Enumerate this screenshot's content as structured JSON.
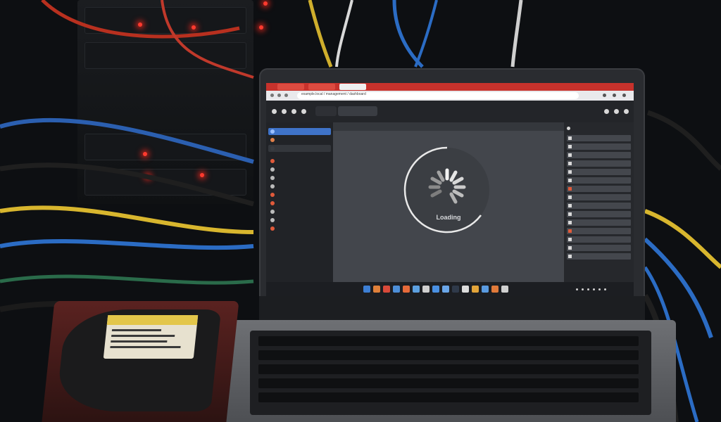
{
  "browser": {
    "address": "example.local / management / dashboard"
  },
  "main": {
    "status": "Loading"
  },
  "colors": {
    "accent": "#3f73c8",
    "tab_red": "#c7322c",
    "led_red": "#ff3a2e",
    "drive_label": "#e3c64a"
  },
  "icons": [
    "back-icon",
    "forward-icon",
    "reload-icon",
    "home-icon",
    "settings-icon",
    "menu-icon",
    "spinner-icon"
  ]
}
